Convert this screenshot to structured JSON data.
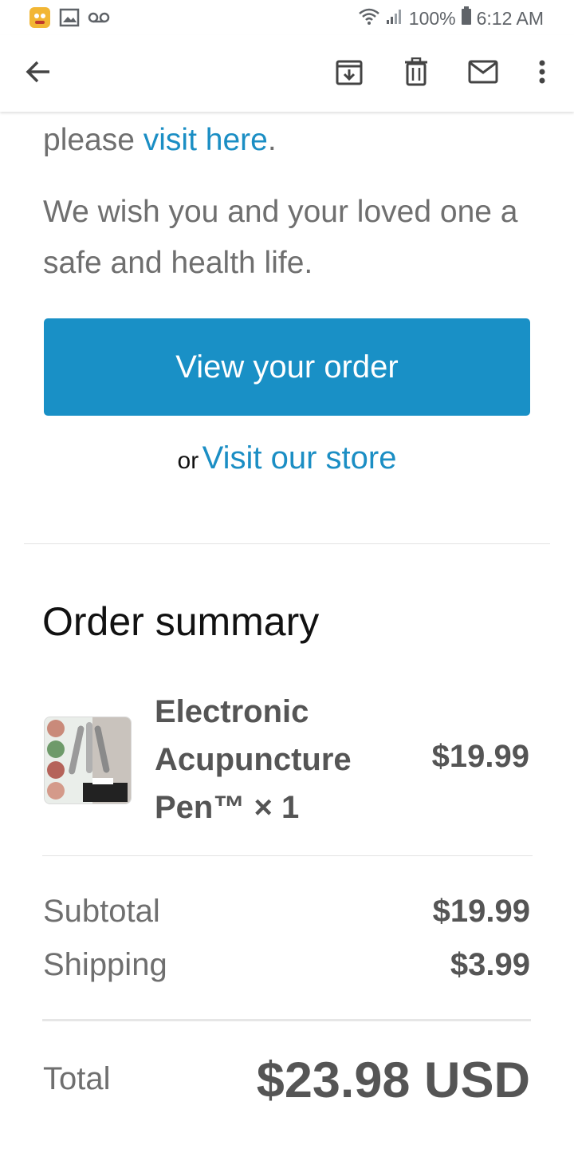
{
  "status_bar": {
    "battery_percent": "100%",
    "time": "6:12 AM",
    "icons": [
      "app-notification-icon",
      "gallery-icon",
      "voicemail-icon",
      "wifi-icon",
      "signal-icon",
      "battery-icon"
    ]
  },
  "toolbar": {
    "back_icon": "arrow-left-icon",
    "archive_icon": "archive-icon",
    "delete_icon": "trash-icon",
    "mark_unread_icon": "mail-icon",
    "more_icon": "more-vert-icon"
  },
  "email": {
    "visit_prefix": "please ",
    "visit_link": "visit here",
    "visit_suffix": ".",
    "wish_text": "We wish you and your loved one a safe and health life.",
    "cta_label": "View your order",
    "or_text": "or",
    "store_link": "Visit our store"
  },
  "order_summary": {
    "title": "Order summary",
    "items": [
      {
        "name": "Electronic Acupuncture Pen™ × 1",
        "price": "$19.99"
      }
    ],
    "subtotal_label": "Subtotal",
    "subtotal_value": "$19.99",
    "shipping_label": "Shipping",
    "shipping_value": "$3.99",
    "total_label": "Total",
    "total_value": "$23.98 USD"
  },
  "colors": {
    "link": "#1b8ec4",
    "button": "#1990c6",
    "text_grey": "#6f6f6f",
    "text_dark": "#555555"
  }
}
